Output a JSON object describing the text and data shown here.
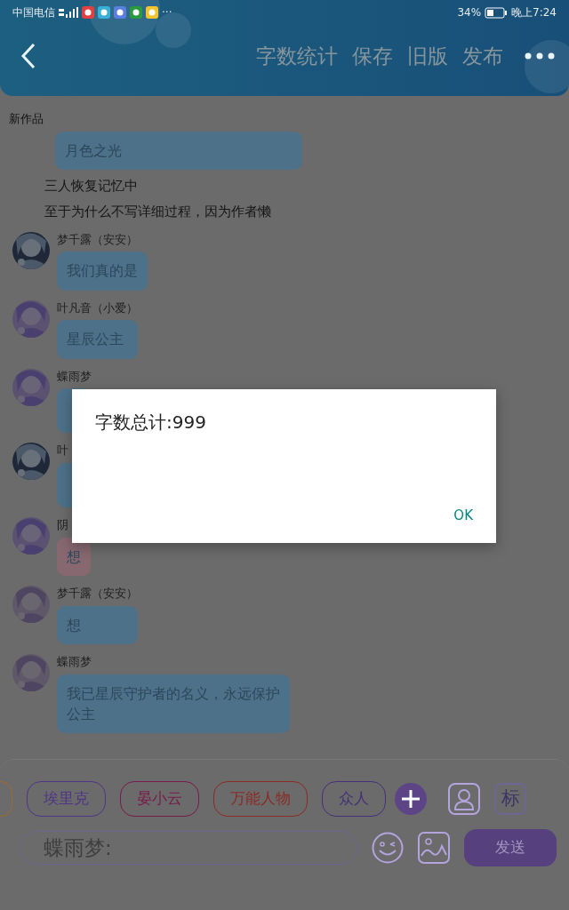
{
  "status_bar": {
    "carrier": "中国电信",
    "more": "···",
    "battery": "34%",
    "time": "晚上7:24"
  },
  "header": {
    "actions": [
      "字数统计",
      "保存",
      "旧版",
      "发布"
    ]
  },
  "section_title": "新作品",
  "feed": [
    {
      "kind": "bubble",
      "text": "月色之光",
      "color": "#4d7189"
    },
    {
      "kind": "narration",
      "text": "三人恢复记忆中"
    },
    {
      "kind": "narration",
      "text": "至于为什么不写详细过程，因为作者懒"
    },
    {
      "kind": "message",
      "name": "梦千露（安安）",
      "text": "我们真的是",
      "color": "#4d7189"
    },
    {
      "kind": "message",
      "name": "叶凡音（小爱）",
      "text": "星辰公主",
      "color": "#4d7189"
    },
    {
      "kind": "message",
      "name": "蝶雨梦",
      "color": "#4d7189"
    },
    {
      "kind": "message",
      "name": "叶",
      "color": "#4d7189"
    },
    {
      "kind": "message",
      "name": "阴",
      "text": "想",
      "color": "#876870"
    },
    {
      "kind": "message",
      "name": "梦千露（安安）",
      "text": "想",
      "color": "#4d7189"
    },
    {
      "kind": "message",
      "name": "蝶雨梦",
      "text": "我已星辰守护者的名义，永远保护公主",
      "color": "#4d7189"
    }
  ],
  "dialog": {
    "message": "字数总计:999",
    "button": "OK"
  },
  "chips": [
    {
      "color": "#9a6c32"
    },
    {
      "label": "埃里克",
      "color": "#4e3486"
    },
    {
      "label": "晏小云",
      "color": "#781a4a"
    },
    {
      "label": "万能人物",
      "color": "#8c2a24"
    },
    {
      "label": "众人",
      "color": "#443078"
    }
  ],
  "tag_button": "标",
  "input": {
    "placeholder": "蝶雨梦:"
  },
  "send_button": "发送"
}
